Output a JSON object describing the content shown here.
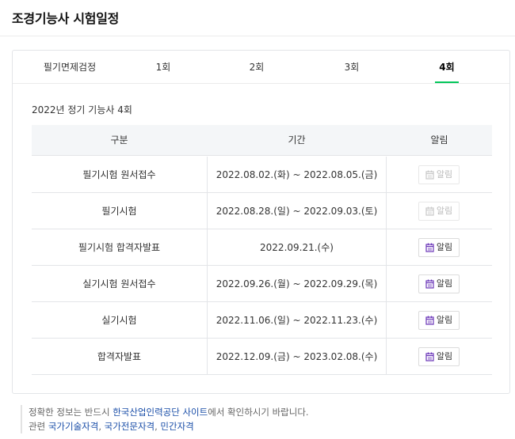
{
  "page": {
    "title": "조경기능사 시험일정"
  },
  "tabs": [
    {
      "label": "필기면제검정",
      "active": false
    },
    {
      "label": "1회",
      "active": false
    },
    {
      "label": "2회",
      "active": false
    },
    {
      "label": "3회",
      "active": false
    },
    {
      "label": "4회",
      "active": true
    }
  ],
  "section": {
    "heading": "2022년 정기 기능사 4회"
  },
  "table": {
    "headers": [
      "구분",
      "기간",
      "알림"
    ],
    "rows": [
      {
        "category": "필기시험 원서접수",
        "period": "2022.08.02.(화) ~ 2022.08.05.(금)",
        "alarm": "알림",
        "alarm_enabled": false
      },
      {
        "category": "필기시험",
        "period": "2022.08.28.(일) ~ 2022.09.03.(토)",
        "alarm": "알림",
        "alarm_enabled": false
      },
      {
        "category": "필기시험 합격자발표",
        "period": "2022.09.21.(수)",
        "alarm": "알림",
        "alarm_enabled": true
      },
      {
        "category": "실기시험 원서접수",
        "period": "2022.09.26.(월) ~ 2022.09.29.(목)",
        "alarm": "알림",
        "alarm_enabled": true
      },
      {
        "category": "실기시험",
        "period": "2022.11.06.(일) ~ 2022.11.23.(수)",
        "alarm": "알림",
        "alarm_enabled": true
      },
      {
        "category": "합격자발표",
        "period": "2022.12.09.(금) ~ 2023.02.08.(수)",
        "alarm": "알림",
        "alarm_enabled": true
      }
    ]
  },
  "footnote": {
    "line1_prefix": "정확한 정보는 반드시 ",
    "line1_link": "한국산업인력공단 사이트",
    "line1_suffix": "에서 확인하시기 바랍니다.",
    "line2_prefix": "관련 ",
    "links": [
      "국가기술자격",
      "국가전문자격",
      "민간자격"
    ],
    "separator": ", "
  },
  "colors": {
    "accent_green": "#03c75a",
    "calendar_icon_active": "#6a35b8",
    "calendar_icon_disabled": "#c8c8c8",
    "link_blue": "#1a4ea8"
  },
  "icons": {
    "alarm": "calendar-icon"
  }
}
